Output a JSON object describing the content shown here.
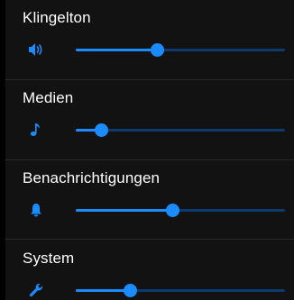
{
  "accent_color": "#1a8cff",
  "sliders": [
    {
      "label": "Klingelton",
      "icon": "speaker-volume-icon",
      "value_percent": 39
    },
    {
      "label": "Medien",
      "icon": "music-note-icon",
      "value_percent": 12
    },
    {
      "label": "Benachrichtigungen",
      "icon": "bell-icon",
      "value_percent": 46
    },
    {
      "label": "System",
      "icon": "wrench-icon",
      "value_percent": 26
    }
  ]
}
